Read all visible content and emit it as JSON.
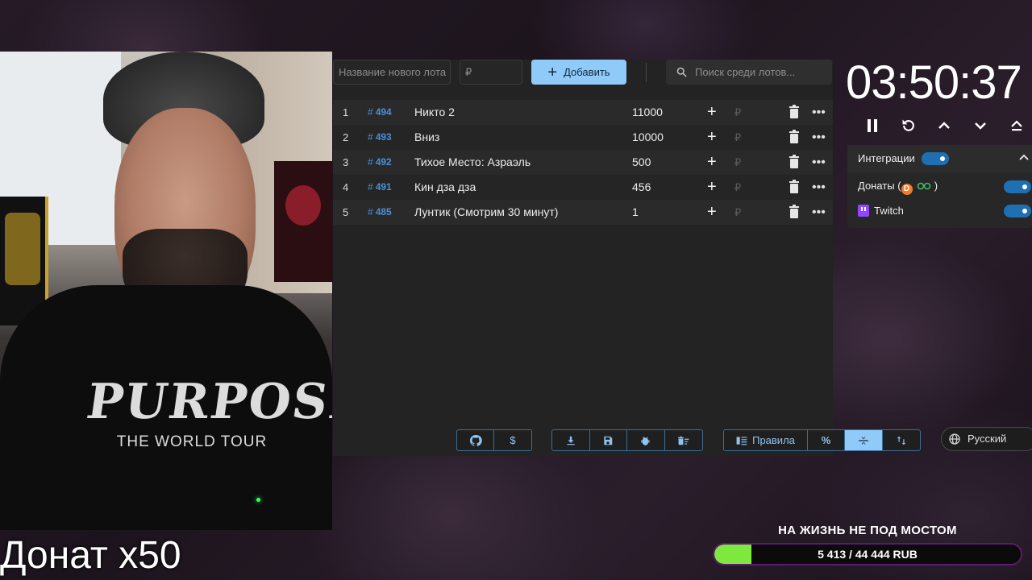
{
  "webcam": {
    "shirt_title": "PURPOSE",
    "shirt_subtitle": "THE WORLD TOUR"
  },
  "overlay": {
    "donation_multiplier": "Донат x50"
  },
  "auction": {
    "name_placeholder": "Название нового лота",
    "price_placeholder": "₽",
    "add_label": "Добавить",
    "search_placeholder": "Поиск среди лотов...",
    "lots": [
      {
        "num": "1",
        "id": "494",
        "name": "Никто 2",
        "amount": "11000"
      },
      {
        "num": "2",
        "id": "493",
        "name": "Вниз",
        "amount": "10000"
      },
      {
        "num": "3",
        "id": "492",
        "name": "Тихое Место: Азраэль",
        "amount": "500"
      },
      {
        "num": "4",
        "id": "491",
        "name": "Кин дза дза",
        "amount": "456"
      },
      {
        "num": "5",
        "id": "485",
        "name": "Лунтик (Смотрим 30 минут)",
        "amount": "1"
      }
    ],
    "rub_symbol": "₽",
    "more_glyph": "•••",
    "plus_glyph": "+"
  },
  "toolbar": {
    "donate_label": "$",
    "rules_label": "Правила",
    "percent_label": "%",
    "language_label": "Русский"
  },
  "timer": {
    "value": "03:50:37"
  },
  "integrations": {
    "title": "Интеграции",
    "enabled": true,
    "donations_label": "Донаты (",
    "donations_suffix": " )",
    "twitch_label": "Twitch",
    "donations_enabled": true,
    "twitch_enabled": true
  },
  "goal": {
    "title": "НА ЖИЗНЬ НЕ ПОД МОСТОМ",
    "progress_text": "5 413 / 44 444 RUB",
    "current": 5413,
    "target": 44444,
    "fill_color": "#7ee83f"
  },
  "colors": {
    "accent": "#90caf9",
    "lot_id": "#4a90d9",
    "panel": "#232323"
  }
}
